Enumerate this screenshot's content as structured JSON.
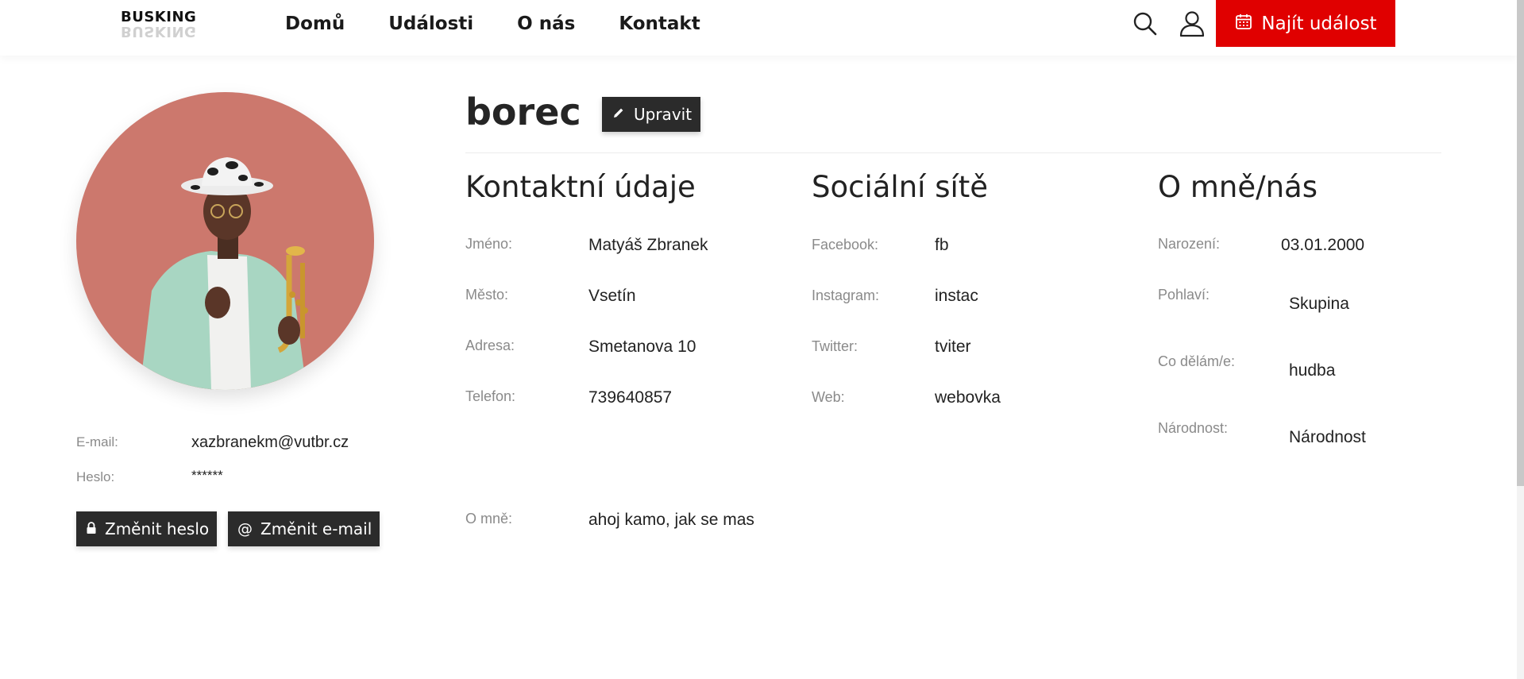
{
  "header": {
    "logo": "BUSKING",
    "nav": [
      "Domů",
      "Události",
      "O nás",
      "Kontakt"
    ],
    "find_event_label": "Najít událost",
    "accent_color": "#e00000"
  },
  "profile": {
    "username": "borec",
    "edit_label": "Upravit",
    "email_label": "E-mail:",
    "email_value": "xazbranekm@vutbr.cz",
    "password_label": "Heslo:",
    "password_value": "******",
    "change_password_label": "Změnit heslo",
    "change_email_label": "Změnit e-mail"
  },
  "contact": {
    "title": "Kontaktní údaje",
    "fields": [
      {
        "label": "Jméno:",
        "value": "Matyáš Zbranek"
      },
      {
        "label": "Město:",
        "value": "Vsetín"
      },
      {
        "label": "Adresa:",
        "value": "Smetanova 10"
      },
      {
        "label": "Telefon:",
        "value": "739640857"
      }
    ],
    "about_label": "O mně:",
    "about_value": "ahoj kamo, jak se mas"
  },
  "social": {
    "title": "Sociální sítě",
    "fields": [
      {
        "label": "Facebook:",
        "value": "fb"
      },
      {
        "label": "Instagram:",
        "value": "instac"
      },
      {
        "label": "Twitter:",
        "value": "tviter"
      },
      {
        "label": "Web:",
        "value": "webovka"
      }
    ]
  },
  "about": {
    "title": "O mně/nás",
    "fields": [
      {
        "label": "Narození:",
        "value": "03.01.2000"
      },
      {
        "label": "Pohlaví:",
        "value": "Skupina"
      },
      {
        "label": "Co dělám/e:",
        "value": "hudba"
      },
      {
        "label": "Národnost:",
        "value": "Národnost"
      }
    ]
  }
}
